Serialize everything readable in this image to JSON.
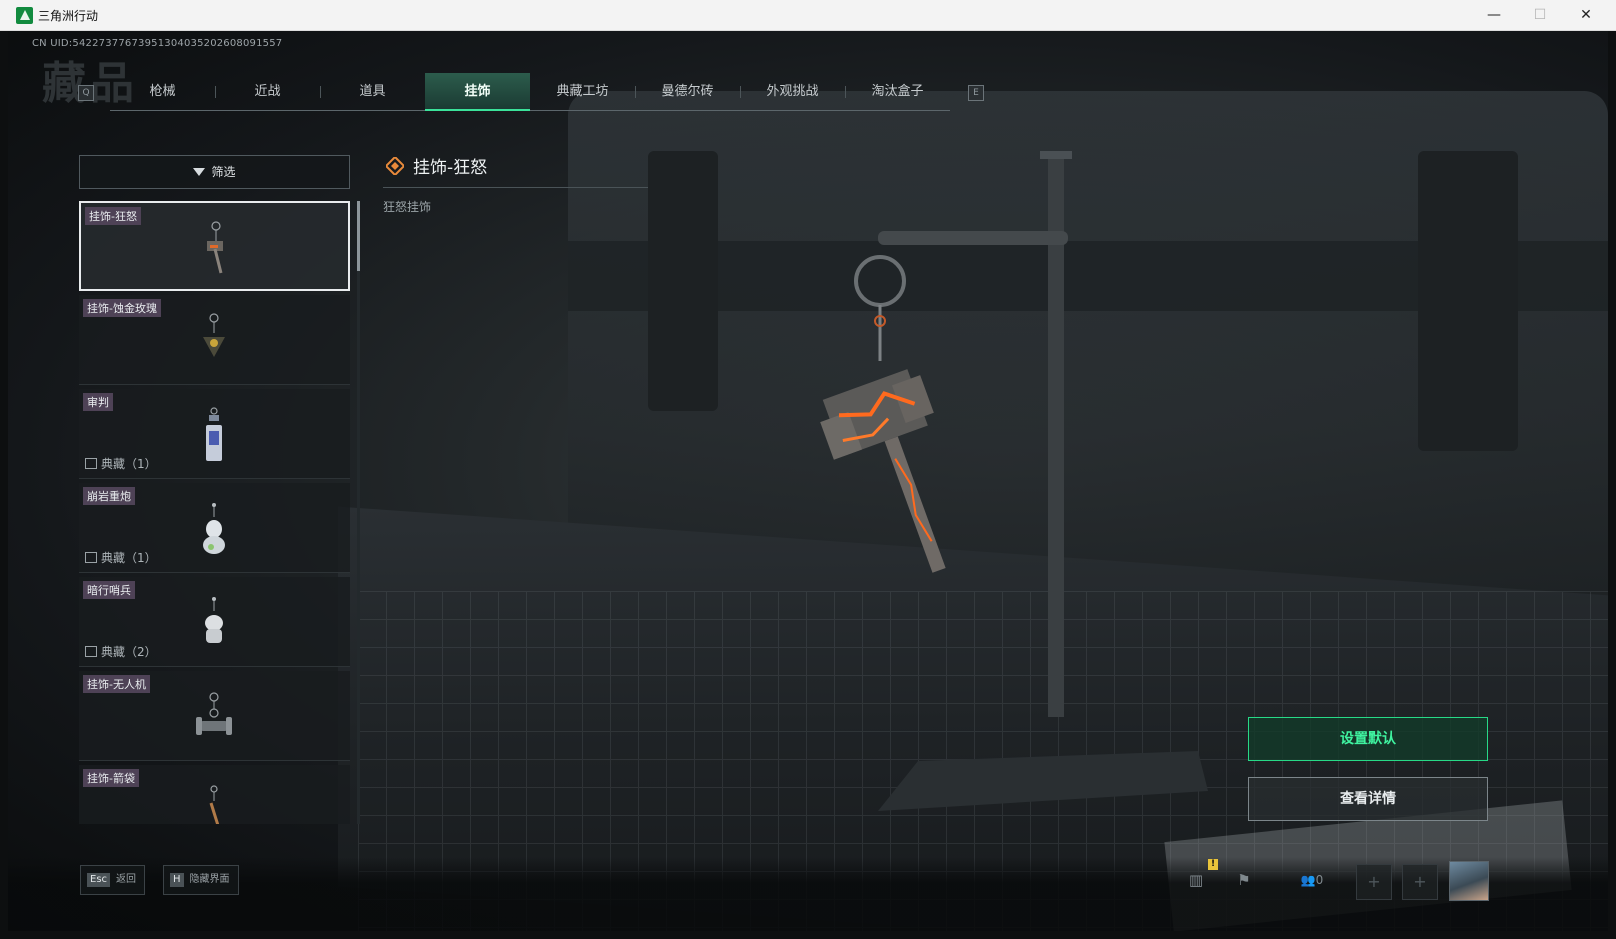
{
  "window": {
    "title": "三角洲行动",
    "minimize": "—",
    "maximize": "☐",
    "close": "✕"
  },
  "header": {
    "uid": "CN UID:542273776739513040352026080915​57",
    "bg_title": "藏品"
  },
  "tabs": {
    "key_left": "Q",
    "key_right": "E",
    "items": [
      {
        "label": "枪械"
      },
      {
        "label": "近战"
      },
      {
        "label": "道具"
      },
      {
        "label": "挂饰"
      },
      {
        "label": "典藏工坊"
      },
      {
        "label": "曼德尔砖"
      },
      {
        "label": "外观挑战"
      },
      {
        "label": "淘汰盒子"
      }
    ],
    "active": "挂饰"
  },
  "filter": {
    "label": "筛选",
    "icon": "filter-icon"
  },
  "list": [
    {
      "name": "挂饰-狂怒",
      "sub": ""
    },
    {
      "name": "挂饰-蚀金玫瑰",
      "sub": ""
    },
    {
      "name": "审判",
      "sub": "典藏（1）"
    },
    {
      "name": "崩岩重炮",
      "sub": "典藏（1）"
    },
    {
      "name": "暗行哨兵",
      "sub": "典藏（2）"
    },
    {
      "name": "挂饰-无人机",
      "sub": ""
    },
    {
      "name": "挂饰-箭袋",
      "sub": ""
    }
  ],
  "detail": {
    "title": "挂饰-狂怒",
    "desc": "狂怒挂饰",
    "icon": "diamond-icon"
  },
  "actions": {
    "set_default": "设置默认",
    "view_details": "查看详情"
  },
  "footer": {
    "esc_key": "Esc",
    "esc_label": "返回",
    "hide_key": "H",
    "hide_label": "隐藏界面",
    "friends_count": "0",
    "notice_badge": "!"
  },
  "colors": {
    "accent": "#3be29a",
    "card_label": "#4e4256",
    "selected_border": "#e9ecee"
  }
}
